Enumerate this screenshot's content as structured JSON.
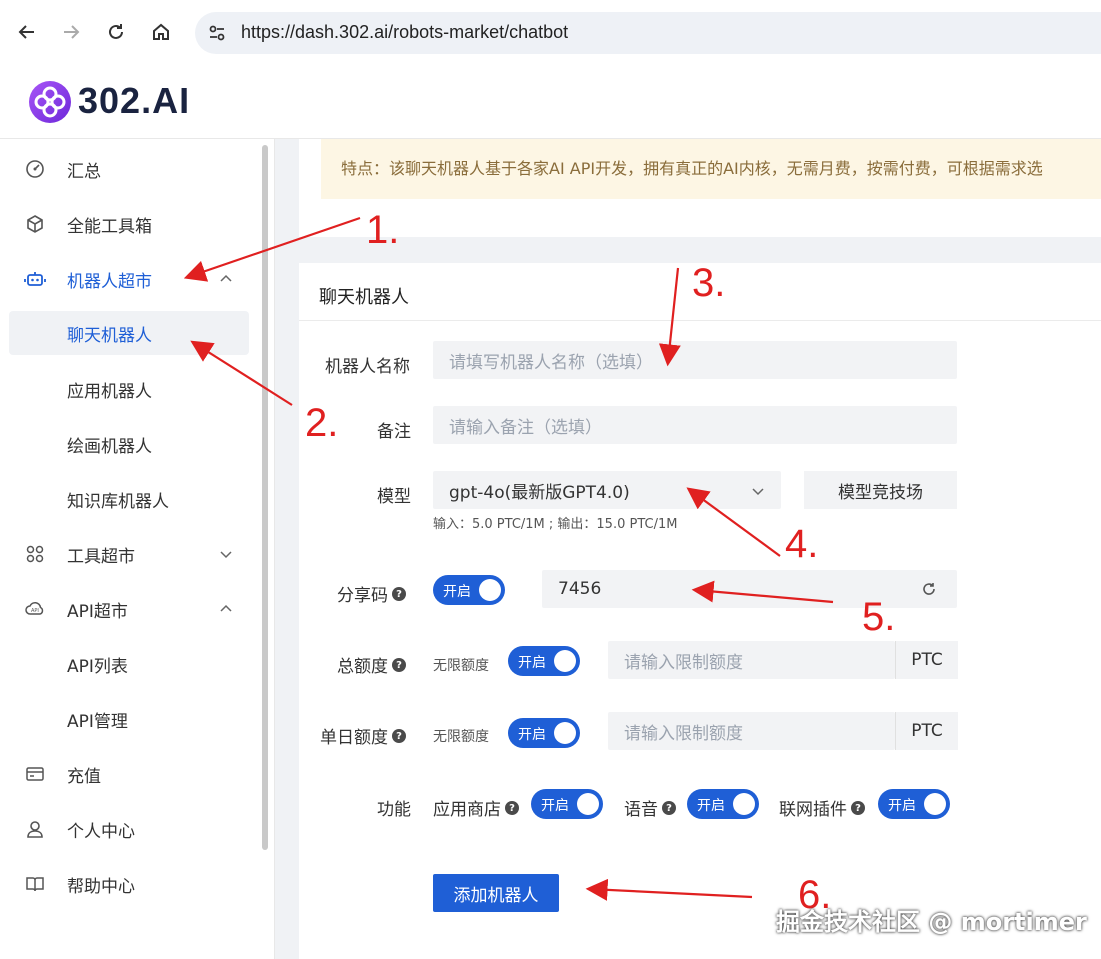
{
  "browser": {
    "url": "https://dash.302.ai/robots-market/chatbot"
  },
  "app": {
    "logo_main": "302.",
    "logo_ai": "AI",
    "accent": "#1f5fd6",
    "brand": "#7c3aed"
  },
  "sidebar": {
    "items": [
      {
        "label": "汇总",
        "icon": "dashboard-icon"
      },
      {
        "label": "全能工具箱",
        "icon": "cube-icon"
      },
      {
        "label": "机器人超市",
        "icon": "robot-icon"
      },
      {
        "label": "聊天机器人"
      },
      {
        "label": "应用机器人"
      },
      {
        "label": "绘画机器人"
      },
      {
        "label": "知识库机器人"
      },
      {
        "label": "工具超市",
        "icon": "grid-icon"
      },
      {
        "label": "API超市",
        "icon": "api-cloud-icon"
      },
      {
        "label": "API列表"
      },
      {
        "label": "API管理"
      },
      {
        "label": "充值",
        "icon": "card-icon"
      },
      {
        "label": "个人中心",
        "icon": "user-icon"
      },
      {
        "label": "帮助中心",
        "icon": "book-icon"
      }
    ]
  },
  "notice": {
    "text": "特点：该聊天机器人基于各家AI API开发，拥有真正的AI内核，无需月费，按需付费，可根据需求选"
  },
  "form": {
    "title": "聊天机器人",
    "name_label": "机器人名称",
    "name_placeholder": "请填写机器人名称（选填）",
    "note_label": "备注",
    "note_placeholder": "请输入备注（选填）",
    "model_label": "模型",
    "model_value": "gpt-4o(最新版GPT4.0)",
    "model_arena_button": "模型竞技场",
    "model_price": "输入：5.0 PTC/1M ; 输出：15.0 PTC/1M",
    "share_label": "分享码",
    "share_toggle": "开启",
    "share_code": "7456",
    "total_label": "总额度",
    "unlimited": "无限额度",
    "total_toggle": "开启",
    "limit_placeholder": "请输入限制额度",
    "unit": "PTC",
    "daily_label": "单日额度",
    "daily_toggle": "开启",
    "feature_label": "功能",
    "feature_store": "应用商店",
    "feature_store_toggle": "开启",
    "feature_voice": "语音",
    "feature_voice_toggle": "开启",
    "feature_web": "联网插件",
    "feature_web_toggle": "开启",
    "submit_button": "添加机器人"
  },
  "annotations": [
    "1.",
    "2.",
    "3.",
    "4.",
    "5.",
    "6."
  ],
  "watermark": "掘金技术社区 @ mortimer"
}
